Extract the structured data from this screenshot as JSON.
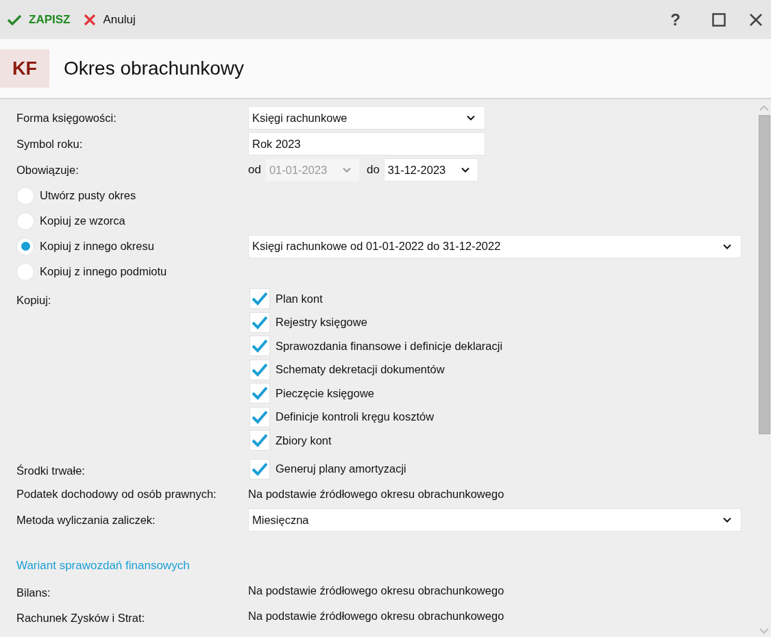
{
  "toolbar": {
    "save": "ZAPISZ",
    "cancel": "Anuluj",
    "help": "?"
  },
  "header": {
    "badge": "KF",
    "title": "Okres obrachunkowy"
  },
  "forma": {
    "label": "Forma księgowości:",
    "value": "Księgi rachunkowe"
  },
  "symbol": {
    "label": "Symbol roku:",
    "value": "Rok 2023"
  },
  "obowiazuje": {
    "label": "Obowiązuje:",
    "from_label": "od",
    "from_value": "01-01-2023",
    "from_disabled": true,
    "to_label": "do",
    "to_value": "31-12-2023",
    "to_disabled": false
  },
  "options": [
    {
      "label": "Utwórz pusty okres",
      "selected": false
    },
    {
      "label": "Kopiuj ze wzorca",
      "selected": false
    },
    {
      "label": "Kopiuj z innego okresu",
      "selected": true,
      "dropdown": "Księgi rachunkowe od 01-01-2022 do 31-12-2022"
    },
    {
      "label": "Kopiuj z innego podmiotu",
      "selected": false
    }
  ],
  "kopiuj": {
    "label": "Kopiuj:",
    "items": [
      {
        "label": "Plan kont",
        "checked": true
      },
      {
        "label": "Rejestry księgowe",
        "checked": true
      },
      {
        "label": "Sprawozdania finansowe i definicje deklaracji",
        "checked": true
      },
      {
        "label": "Schematy dekretacji dokumentów",
        "checked": true
      },
      {
        "label": "Pieczęcie księgowe",
        "checked": true
      },
      {
        "label": "Definicje kontroli kręgu kosztów",
        "checked": true
      },
      {
        "label": "Zbiory kont",
        "checked": true
      }
    ]
  },
  "srodki": {
    "label": "Środki trwałe:",
    "items": [
      {
        "label": "Generuj plany amortyzacji",
        "checked": true
      }
    ]
  },
  "podatek": {
    "label": "Podatek dochodowy od osób prawnych:",
    "value": "Na podstawie źródłowego okresu obrachunkowego"
  },
  "metoda": {
    "label": "Metoda wyliczania zaliczek:",
    "value": "Miesięczna"
  },
  "section_title": "Wariant sprawozdań finansowych",
  "reports": [
    {
      "label": "Bilans:",
      "value": "Na podstawie źródłowego okresu obrachunkowego"
    },
    {
      "label": "Rachunek Zysków i Strat:",
      "value": "Na podstawie źródłowego okresu obrachunkowego"
    }
  ]
}
